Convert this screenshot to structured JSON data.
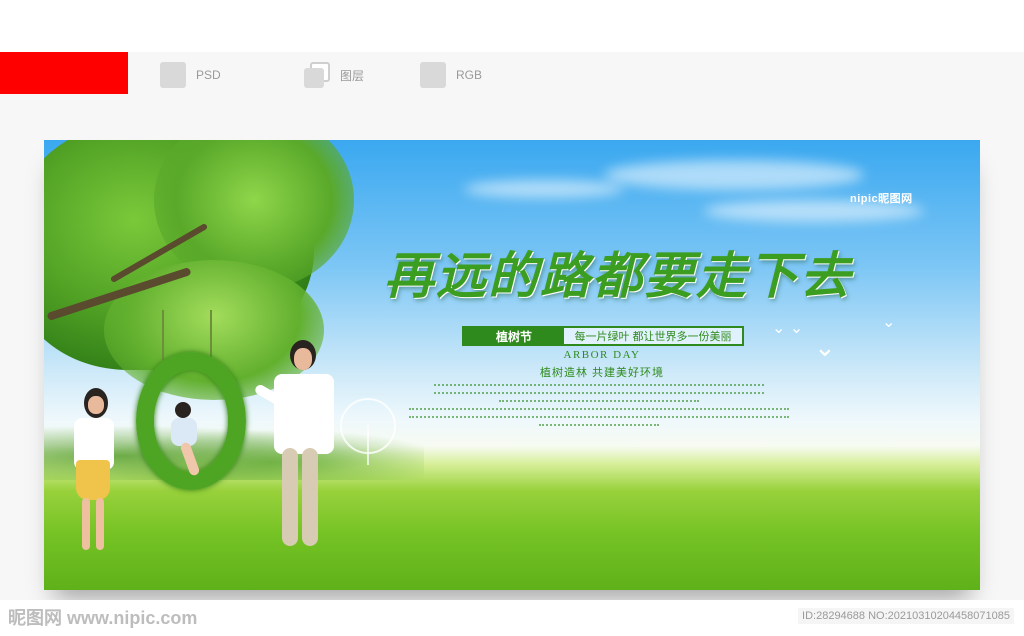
{
  "toolbar": {
    "items": [
      {
        "icon": "psd-file-icon",
        "label": "PSD"
      },
      {
        "icon": "layers-icon",
        "label": "图层"
      },
      {
        "icon": "rgb-color-icon",
        "label": "RGB"
      }
    ]
  },
  "banner": {
    "watermark_logo": "nipic昵图网",
    "headline": "再远的路都要走下去",
    "tag_left": "植树节",
    "tag_right": "每一片绿叶 都让世界多一份美丽",
    "subtitle_en": "ARBOR DAY",
    "slogan": "植树造林 共建美好环境"
  },
  "footer": {
    "site_mark": "昵图网 www.nipic.com",
    "id_text": "ID:28294688 NO:20210310204458071085"
  },
  "colors": {
    "brand_red": "#ff0000",
    "text_green": "#2f8a1d",
    "headline_green": "#3c9e20"
  }
}
